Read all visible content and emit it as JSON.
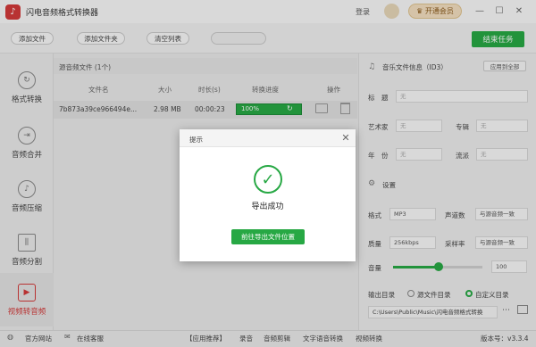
{
  "app": {
    "title": "闪电音频格式转换器",
    "icon": "music-note-icon",
    "login": "登录",
    "vip": "开通会员"
  },
  "window": {
    "minimize": "—",
    "maximize": "☐",
    "close": "✕"
  },
  "toolbar": {
    "add_file": "添加文件",
    "add_folder": "添加文件夹",
    "clear_list": "清空列表",
    "end_task": "结束任务"
  },
  "sidebar": {
    "items": [
      {
        "label": "格式转换",
        "icon": "refresh-icon"
      },
      {
        "label": "音频合并",
        "icon": "merge-icon"
      },
      {
        "label": "音频压缩",
        "icon": "compress-icon"
      },
      {
        "label": "音频分割",
        "icon": "split-icon"
      },
      {
        "label": "视频转音频",
        "icon": "video-play-icon"
      }
    ]
  },
  "list": {
    "title": "源音频文件 (1个)",
    "columns": [
      "文件名",
      "大小",
      "时长(s)",
      "转换进度",
      "操作"
    ],
    "rows": [
      {
        "name": "7b873a39ce966494e...",
        "size": "2.98 MB",
        "duration": "00:00:23",
        "progress": "100%"
      }
    ]
  },
  "id3": {
    "title": "音乐文件信息（ID3）",
    "apply_all": "应用到全部",
    "title_label": "标　题",
    "artist_label": "艺术家",
    "album_label": "专辑",
    "year_label": "年　份",
    "genre_label": "流派",
    "placeholder": "无"
  },
  "settings": {
    "title": "设置",
    "format_label": "格式",
    "format_value": "MP3",
    "channel_label": "声道数",
    "channel_value": "与源音频一致",
    "quality_label": "质量",
    "quality_value": "256kbps",
    "sample_label": "采样率",
    "sample_value": "与源音频一致",
    "volume_label": "音量",
    "volume_value": "100",
    "output_label": "输出目录",
    "source_dir": "源文件目录",
    "custom_dir": "自定义目录",
    "path": "C:\\Users\\Public\\Music\\闪电音频格式转换"
  },
  "bottom": {
    "website": "官方网站",
    "support": "在线客服",
    "recommend": "【应用推荐】",
    "apps": [
      "录音",
      "音频剪辑",
      "文字语音转换",
      "视频转换"
    ],
    "version": "版本号：v3.3.4"
  },
  "dialog": {
    "title": "提示",
    "message": "导出成功",
    "button": "前往导出文件位置",
    "close": "✕",
    "check": "✓"
  }
}
